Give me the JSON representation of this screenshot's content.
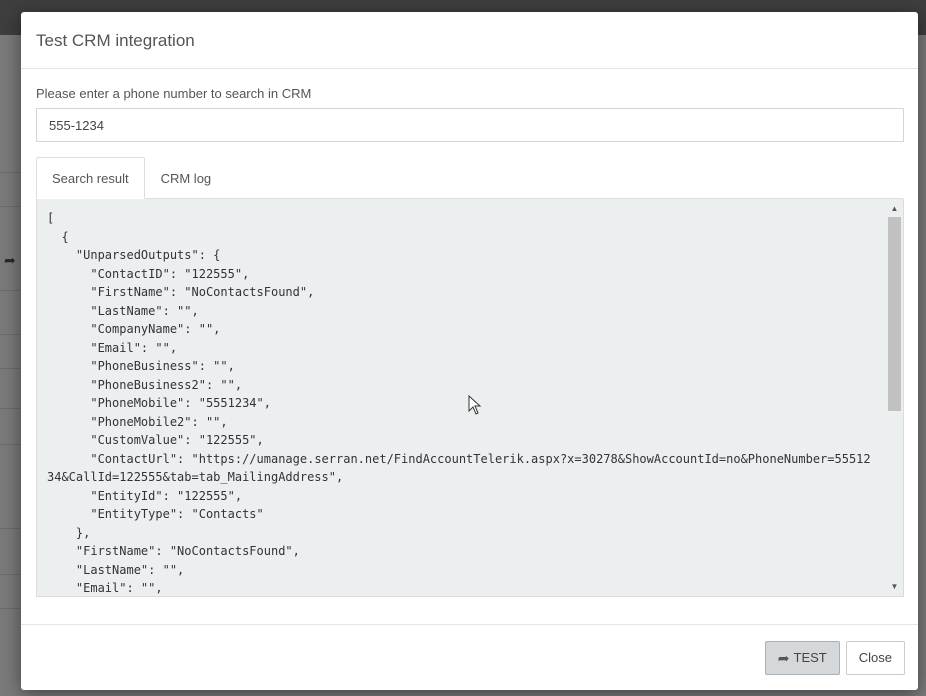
{
  "modal": {
    "title": "Test CRM integration",
    "phone_label": "Please enter a phone number to search in CRM",
    "phone_value": "555-1234",
    "tabs": [
      {
        "label": "Search result",
        "active": true
      },
      {
        "label": "CRM log",
        "active": false
      }
    ],
    "result_text": "[\n  {\n    \"UnparsedOutputs\": {\n      \"ContactID\": \"122555\",\n      \"FirstName\": \"NoContactsFound\",\n      \"LastName\": \"\",\n      \"CompanyName\": \"\",\n      \"Email\": \"\",\n      \"PhoneBusiness\": \"\",\n      \"PhoneBusiness2\": \"\",\n      \"PhoneMobile\": \"5551234\",\n      \"PhoneMobile2\": \"\",\n      \"CustomValue\": \"122555\",\n      \"ContactUrl\": \"https://umanage.serran.net/FindAccountTelerik.aspx?x=30278&ShowAccountId=no&PhoneNumber=5551234&CallId=122555&tab=tab_MailingAddress\",\n      \"EntityId\": \"122555\",\n      \"EntityType\": \"Contacts\"\n    },\n    \"FirstName\": \"NoContactsFound\",\n    \"LastName\": \"\",\n    \"Email\": \"\",",
    "footer": {
      "test_label": "TEST",
      "close_label": "Close"
    }
  },
  "icons": {
    "test_icon": "share-icon",
    "scroll_up": "arrow-up-icon",
    "scroll_down": "arrow-down-icon"
  }
}
